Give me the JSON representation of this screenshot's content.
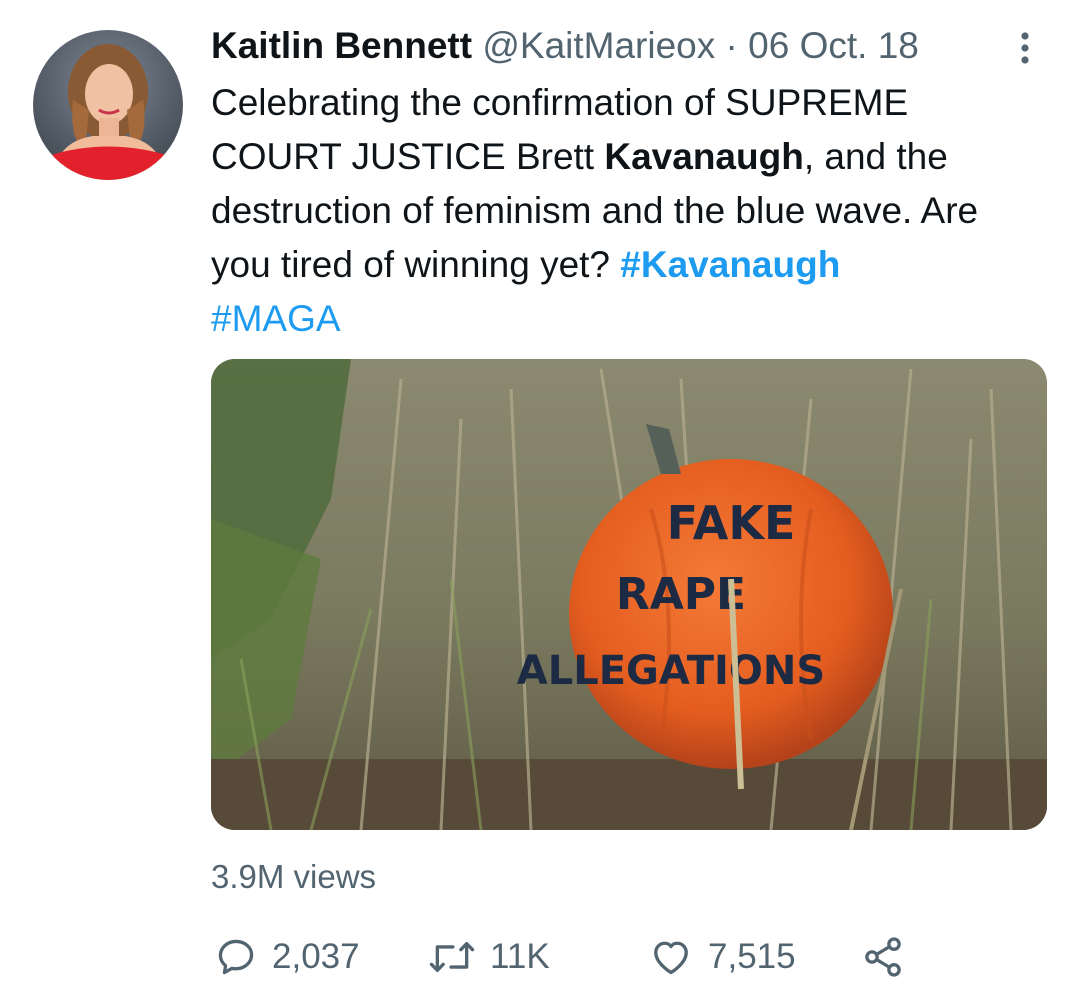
{
  "tweet": {
    "author_name": "Kaitlin Bennett",
    "handle": "@KaitMarieox",
    "separator": "·",
    "date": "06 Oct. 18",
    "text": {
      "part1": "Celebrating the confirmation of SUPREME COURT JUSTICE Brett ",
      "bold": "Kavanaugh",
      "part2": ", and the destruction of feminism and the blue wave. Are you tired of winning yet? ",
      "hashtag1": "#Kavanaugh",
      "hashtag2": "#MAGA"
    },
    "media": {
      "pumpkin_text": [
        "FAKE",
        "RAPE",
        "ALLEGATIONS"
      ]
    },
    "views": "3.9M views",
    "actions": {
      "reply_count": "2,037",
      "retweet_count": "11K",
      "like_count": "7,515"
    }
  },
  "icons": {
    "more": "more-vertical-icon",
    "reply": "reply-icon",
    "retweet": "retweet-icon",
    "like": "heart-icon",
    "share": "share-icon"
  },
  "colors": {
    "accent": "#1d9bf0",
    "secondary_text": "#536471",
    "primary_text": "#0f1419"
  }
}
